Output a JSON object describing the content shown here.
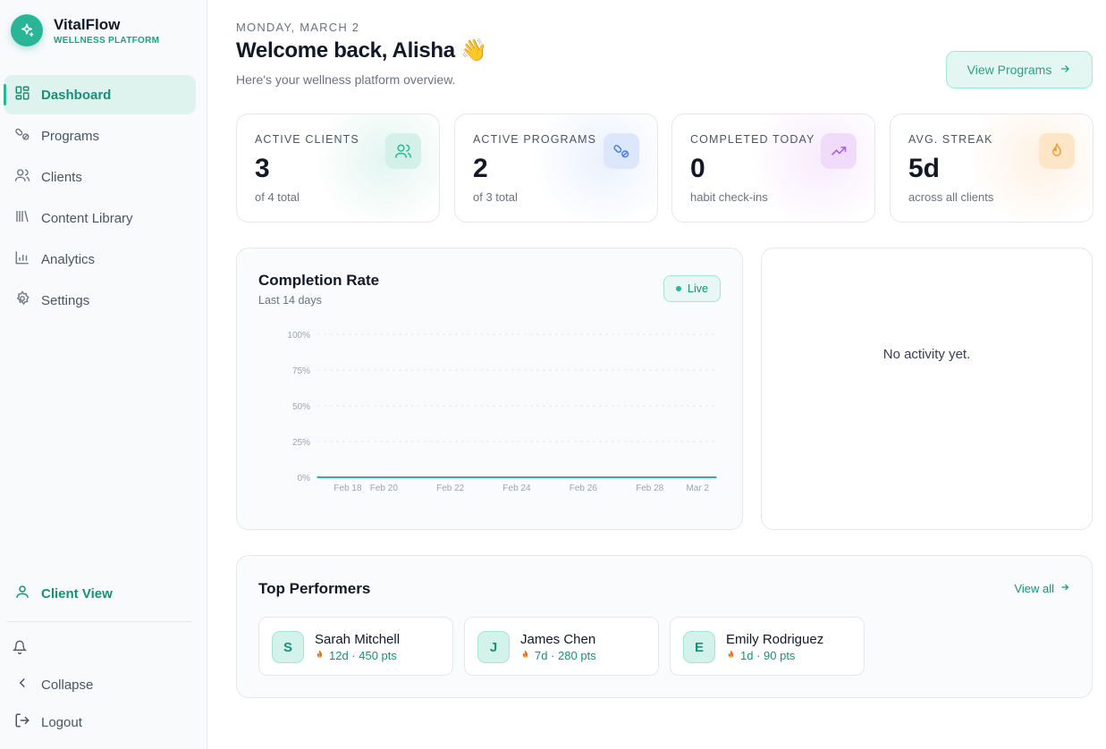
{
  "brand": {
    "name": "VitalFlow",
    "subtitle": "WELLNESS PLATFORM"
  },
  "sidebar": {
    "items": [
      {
        "label": "Dashboard",
        "icon": "dashboard-icon",
        "active": true
      },
      {
        "label": "Programs",
        "icon": "pills-icon",
        "active": false
      },
      {
        "label": "Clients",
        "icon": "users-icon",
        "active": false
      },
      {
        "label": "Content Library",
        "icon": "library-icon",
        "active": false
      },
      {
        "label": "Analytics",
        "icon": "bar-chart-icon",
        "active": false
      },
      {
        "label": "Settings",
        "icon": "gear-icon",
        "active": false
      }
    ],
    "client_view": "Client View",
    "collapse": "Collapse",
    "logout": "Logout"
  },
  "header": {
    "date": "MONDAY, MARCH 2",
    "welcome": "Welcome back, Alisha 👋",
    "subtitle": "Here's your wellness platform overview.",
    "view_programs": "View Programs"
  },
  "stats": [
    {
      "label": "ACTIVE CLIENTS",
      "value": "3",
      "sub": "of 4 total",
      "icon": "users-icon",
      "color": "#2bb597"
    },
    {
      "label": "ACTIVE PROGRAMS",
      "value": "2",
      "sub": "of 3 total",
      "icon": "pills-icon",
      "color": "#4a7fe0"
    },
    {
      "label": "COMPLETED TODAY",
      "value": "0",
      "sub": "habit check-ins",
      "icon": "trend-up-icon",
      "color": "#a55be3"
    },
    {
      "label": "AVG. STREAK",
      "value": "5d",
      "sub": "across all clients",
      "icon": "flame-icon",
      "color": "#f0a030"
    }
  ],
  "completion": {
    "title": "Completion Rate",
    "subtitle": "Last 14 days",
    "badge": "Live"
  },
  "chart_data": {
    "type": "line",
    "x": [
      "Feb 18",
      "Feb 19",
      "Feb 20",
      "Feb 21",
      "Feb 22",
      "Feb 23",
      "Feb 24",
      "Feb 25",
      "Feb 26",
      "Feb 27",
      "Feb 28",
      "Mar 1",
      "Mar 2"
    ],
    "x_tick_labels": [
      "Feb 18",
      "Feb 20",
      "Feb 22",
      "Feb 24",
      "Feb 26",
      "Feb 28",
      "Mar 2"
    ],
    "series": [
      {
        "values": [
          0,
          0,
          0,
          0,
          0,
          0,
          0,
          0,
          0,
          0,
          0,
          0,
          0
        ],
        "color": "#2bb597"
      }
    ],
    "y_ticks": [
      "100%",
      "75%",
      "50%",
      "25%",
      "0%"
    ],
    "ylim": [
      0,
      100
    ],
    "grid": true
  },
  "activity": {
    "empty": "No activity yet."
  },
  "top_performers": {
    "title": "Top Performers",
    "view_all": "View all",
    "items": [
      {
        "initial": "S",
        "name": "Sarah Mitchell",
        "stats": "12d · 450 pts"
      },
      {
        "initial": "J",
        "name": "James Chen",
        "stats": "7d · 280 pts"
      },
      {
        "initial": "E",
        "name": "Emily Rodriguez",
        "stats": "1d · 90 pts"
      }
    ]
  },
  "colors": {
    "accent": "#2bb597",
    "accent_dark": "#1a8f76"
  }
}
